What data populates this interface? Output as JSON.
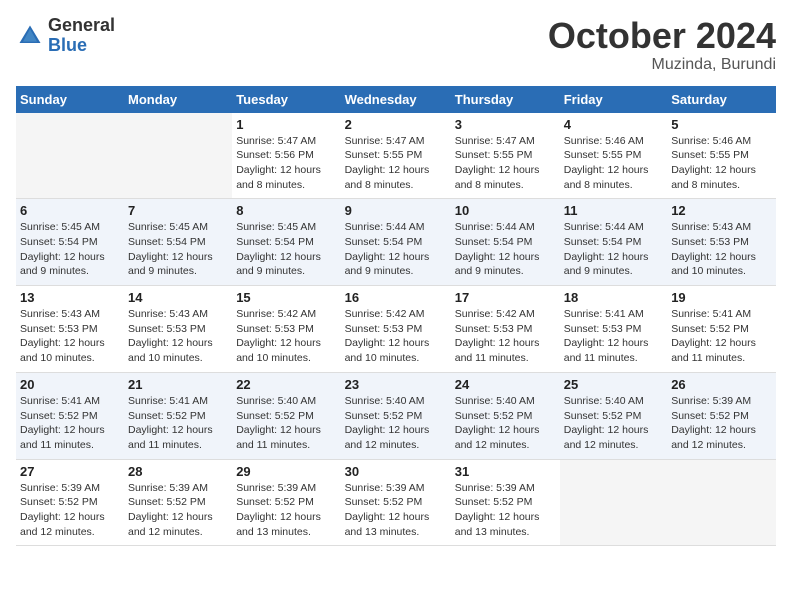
{
  "header": {
    "logo_general": "General",
    "logo_blue": "Blue",
    "month_title": "October 2024",
    "location": "Muzinda, Burundi"
  },
  "calendar": {
    "days_of_week": [
      "Sunday",
      "Monday",
      "Tuesday",
      "Wednesday",
      "Thursday",
      "Friday",
      "Saturday"
    ],
    "weeks": [
      [
        {
          "day": "",
          "info": ""
        },
        {
          "day": "",
          "info": ""
        },
        {
          "day": "1",
          "info": "Sunrise: 5:47 AM\nSunset: 5:56 PM\nDaylight: 12 hours and 8 minutes."
        },
        {
          "day": "2",
          "info": "Sunrise: 5:47 AM\nSunset: 5:55 PM\nDaylight: 12 hours and 8 minutes."
        },
        {
          "day": "3",
          "info": "Sunrise: 5:47 AM\nSunset: 5:55 PM\nDaylight: 12 hours and 8 minutes."
        },
        {
          "day": "4",
          "info": "Sunrise: 5:46 AM\nSunset: 5:55 PM\nDaylight: 12 hours and 8 minutes."
        },
        {
          "day": "5",
          "info": "Sunrise: 5:46 AM\nSunset: 5:55 PM\nDaylight: 12 hours and 8 minutes."
        }
      ],
      [
        {
          "day": "6",
          "info": "Sunrise: 5:45 AM\nSunset: 5:54 PM\nDaylight: 12 hours and 9 minutes."
        },
        {
          "day": "7",
          "info": "Sunrise: 5:45 AM\nSunset: 5:54 PM\nDaylight: 12 hours and 9 minutes."
        },
        {
          "day": "8",
          "info": "Sunrise: 5:45 AM\nSunset: 5:54 PM\nDaylight: 12 hours and 9 minutes."
        },
        {
          "day": "9",
          "info": "Sunrise: 5:44 AM\nSunset: 5:54 PM\nDaylight: 12 hours and 9 minutes."
        },
        {
          "day": "10",
          "info": "Sunrise: 5:44 AM\nSunset: 5:54 PM\nDaylight: 12 hours and 9 minutes."
        },
        {
          "day": "11",
          "info": "Sunrise: 5:44 AM\nSunset: 5:54 PM\nDaylight: 12 hours and 9 minutes."
        },
        {
          "day": "12",
          "info": "Sunrise: 5:43 AM\nSunset: 5:53 PM\nDaylight: 12 hours and 10 minutes."
        }
      ],
      [
        {
          "day": "13",
          "info": "Sunrise: 5:43 AM\nSunset: 5:53 PM\nDaylight: 12 hours and 10 minutes."
        },
        {
          "day": "14",
          "info": "Sunrise: 5:43 AM\nSunset: 5:53 PM\nDaylight: 12 hours and 10 minutes."
        },
        {
          "day": "15",
          "info": "Sunrise: 5:42 AM\nSunset: 5:53 PM\nDaylight: 12 hours and 10 minutes."
        },
        {
          "day": "16",
          "info": "Sunrise: 5:42 AM\nSunset: 5:53 PM\nDaylight: 12 hours and 10 minutes."
        },
        {
          "day": "17",
          "info": "Sunrise: 5:42 AM\nSunset: 5:53 PM\nDaylight: 12 hours and 11 minutes."
        },
        {
          "day": "18",
          "info": "Sunrise: 5:41 AM\nSunset: 5:53 PM\nDaylight: 12 hours and 11 minutes."
        },
        {
          "day": "19",
          "info": "Sunrise: 5:41 AM\nSunset: 5:52 PM\nDaylight: 12 hours and 11 minutes."
        }
      ],
      [
        {
          "day": "20",
          "info": "Sunrise: 5:41 AM\nSunset: 5:52 PM\nDaylight: 12 hours and 11 minutes."
        },
        {
          "day": "21",
          "info": "Sunrise: 5:41 AM\nSunset: 5:52 PM\nDaylight: 12 hours and 11 minutes."
        },
        {
          "day": "22",
          "info": "Sunrise: 5:40 AM\nSunset: 5:52 PM\nDaylight: 12 hours and 11 minutes."
        },
        {
          "day": "23",
          "info": "Sunrise: 5:40 AM\nSunset: 5:52 PM\nDaylight: 12 hours and 12 minutes."
        },
        {
          "day": "24",
          "info": "Sunrise: 5:40 AM\nSunset: 5:52 PM\nDaylight: 12 hours and 12 minutes."
        },
        {
          "day": "25",
          "info": "Sunrise: 5:40 AM\nSunset: 5:52 PM\nDaylight: 12 hours and 12 minutes."
        },
        {
          "day": "26",
          "info": "Sunrise: 5:39 AM\nSunset: 5:52 PM\nDaylight: 12 hours and 12 minutes."
        }
      ],
      [
        {
          "day": "27",
          "info": "Sunrise: 5:39 AM\nSunset: 5:52 PM\nDaylight: 12 hours and 12 minutes."
        },
        {
          "day": "28",
          "info": "Sunrise: 5:39 AM\nSunset: 5:52 PM\nDaylight: 12 hours and 12 minutes."
        },
        {
          "day": "29",
          "info": "Sunrise: 5:39 AM\nSunset: 5:52 PM\nDaylight: 12 hours and 13 minutes."
        },
        {
          "day": "30",
          "info": "Sunrise: 5:39 AM\nSunset: 5:52 PM\nDaylight: 12 hours and 13 minutes."
        },
        {
          "day": "31",
          "info": "Sunrise: 5:39 AM\nSunset: 5:52 PM\nDaylight: 12 hours and 13 minutes."
        },
        {
          "day": "",
          "info": ""
        },
        {
          "day": "",
          "info": ""
        }
      ]
    ]
  }
}
